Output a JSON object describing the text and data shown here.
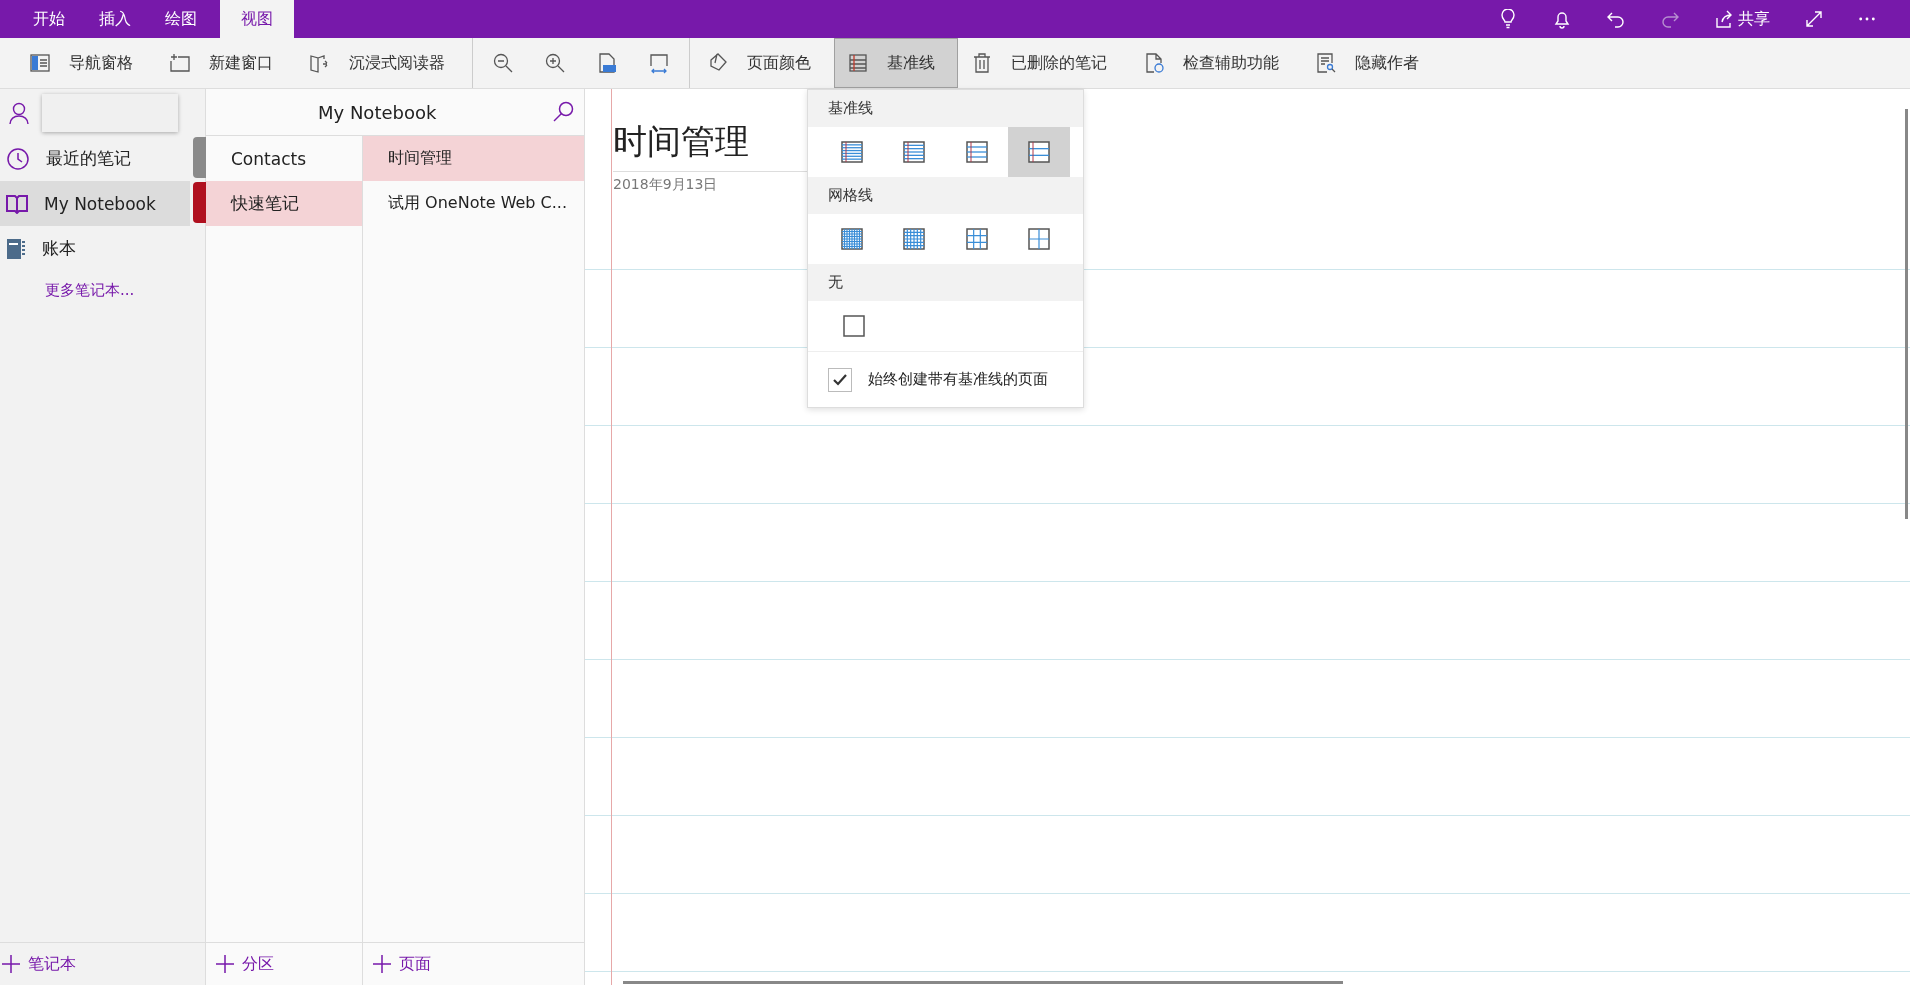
{
  "menu_tabs": [
    {
      "label": "开始",
      "selected": false
    },
    {
      "label": "插入",
      "selected": false
    },
    {
      "label": "绘图",
      "selected": false
    },
    {
      "label": "视图",
      "selected": true
    }
  ],
  "title_actions": [
    {
      "kind": "lightbulb",
      "disabled": false
    },
    {
      "kind": "bell",
      "disabled": false
    },
    {
      "kind": "undo",
      "disabled": false
    },
    {
      "kind": "redo",
      "disabled": true
    },
    {
      "kind": "share",
      "label": "共享",
      "disabled": false
    },
    {
      "kind": "expand",
      "disabled": false
    },
    {
      "kind": "more",
      "disabled": false
    }
  ],
  "ribbon_groups": [
    [
      {
        "kind": "nav",
        "label": "导航窗格",
        "selected": false
      },
      {
        "kind": "newwin",
        "label": "新建窗口",
        "selected": false
      },
      {
        "kind": "reader",
        "label": "沉浸式阅读器",
        "selected": false
      }
    ],
    [
      {
        "kind": "zoomout",
        "selected": false
      },
      {
        "kind": "zoomin",
        "selected": false
      },
      {
        "kind": "pagezoom",
        "selected": false
      },
      {
        "kind": "fitwidth",
        "selected": false
      }
    ],
    [
      {
        "kind": "pagecolor",
        "label": "页面颜色",
        "selected": false
      },
      {
        "kind": "ruled",
        "label": "基准线",
        "selected": true
      },
      {
        "kind": "trash",
        "label": "已删除的笔记",
        "selected": false
      },
      {
        "kind": "accessibility",
        "label": "检查辅助功能",
        "selected": false
      },
      {
        "kind": "authors",
        "label": "隐藏作者",
        "selected": false
      }
    ]
  ],
  "notebooks": [
    {
      "kind": "recent",
      "label": "最近的笔记",
      "selected": false
    },
    {
      "kind": "notebook-open",
      "label": "My Notebook",
      "selected": true
    },
    {
      "kind": "notebook",
      "label": "账本",
      "selected": false
    }
  ],
  "more_notebooks": "更多笔记本...",
  "notebook_title": "My Notebook",
  "sections": [
    {
      "label": "Contacts",
      "selected": false,
      "color": "#8a8a8a"
    },
    {
      "label": "快速笔记",
      "selected": true,
      "color": "#b0101f"
    }
  ],
  "pages": [
    {
      "label": "时间管理",
      "selected": true
    },
    {
      "label": "试用 OneNote Web C...",
      "selected": false
    }
  ],
  "add_buttons": {
    "notebook": "笔记本",
    "section": "分区",
    "page": "页面"
  },
  "page": {
    "title": "时间管理",
    "date": "2018年9月13日"
  },
  "rule_lines_menu": {
    "groups": [
      {
        "heading": "基准线",
        "kind": "ruled",
        "options": [
          {
            "selected": false
          },
          {
            "selected": false
          },
          {
            "selected": false
          },
          {
            "selected": true
          }
        ]
      },
      {
        "heading": "网格线",
        "kind": "grid",
        "options": [
          {
            "selected": false
          },
          {
            "selected": false
          },
          {
            "selected": false
          },
          {
            "selected": false
          }
        ]
      },
      {
        "heading": "无",
        "kind": "none",
        "options": [
          {
            "selected": false
          }
        ]
      }
    ],
    "always_create": {
      "label": "始终创建带有基准线的页面",
      "checked": true
    }
  }
}
